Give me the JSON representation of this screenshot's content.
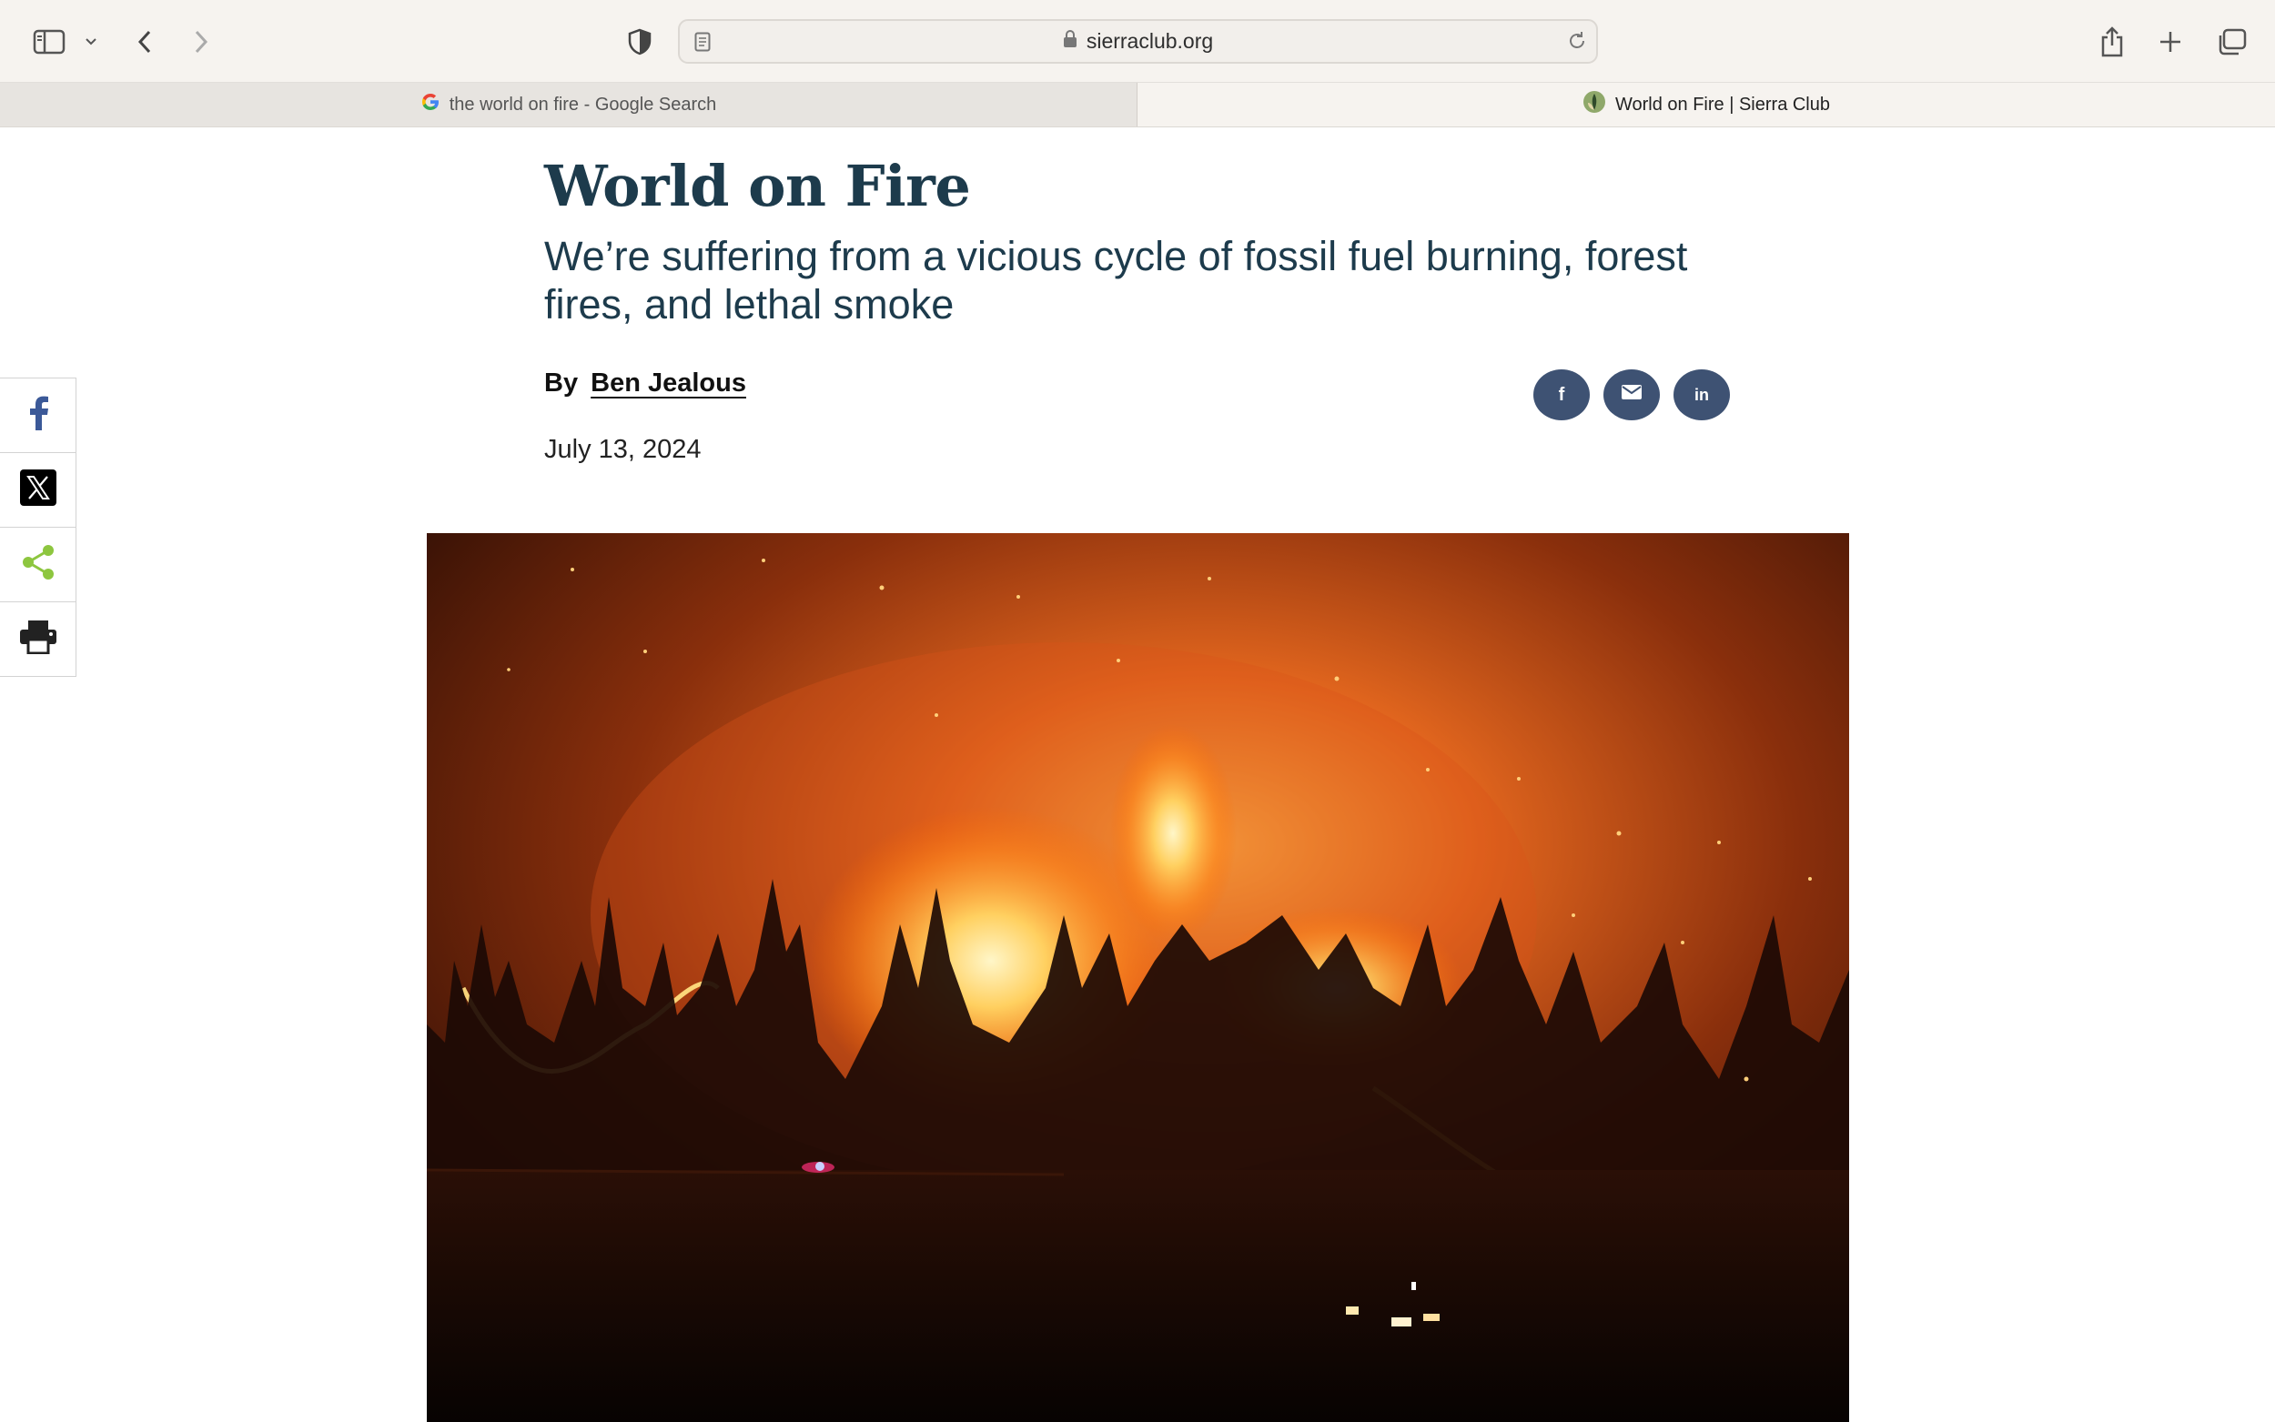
{
  "browser": {
    "url": "sierraclub.org",
    "tabs": [
      {
        "title": "the world on fire - Google Search",
        "active": false
      },
      {
        "title": "World on Fire | Sierra Club",
        "active": true
      }
    ],
    "icons": [
      "sidebar-icon",
      "chevron-down-icon",
      "back-icon",
      "forward-icon",
      "privacy-shield-icon",
      "reader-icon",
      "lock-icon",
      "reload-icon",
      "share-icon",
      "new-tab-icon",
      "tab-overview-icon"
    ]
  },
  "article": {
    "headline": "World on Fire",
    "dek": "We’re suffering from a vicious cycle of fossil fuel burning, forest fires, and lethal smoke",
    "byline_prefix": "By",
    "author": "Ben Jealous",
    "date": "July 13, 2024",
    "share_circle_icons": [
      "facebook-icon",
      "email-icon",
      "linkedin-icon"
    ],
    "share_labels": {
      "facebook": "f",
      "linkedin": "in"
    }
  },
  "sidebar": {
    "buttons": [
      "facebook-icon",
      "x-icon",
      "share-icon",
      "print-icon"
    ]
  },
  "colors": {
    "headline": "#1d3b4c",
    "share_circle": "#3e5273",
    "facebook": "#3b5998",
    "share_green": "#8dc63f"
  }
}
